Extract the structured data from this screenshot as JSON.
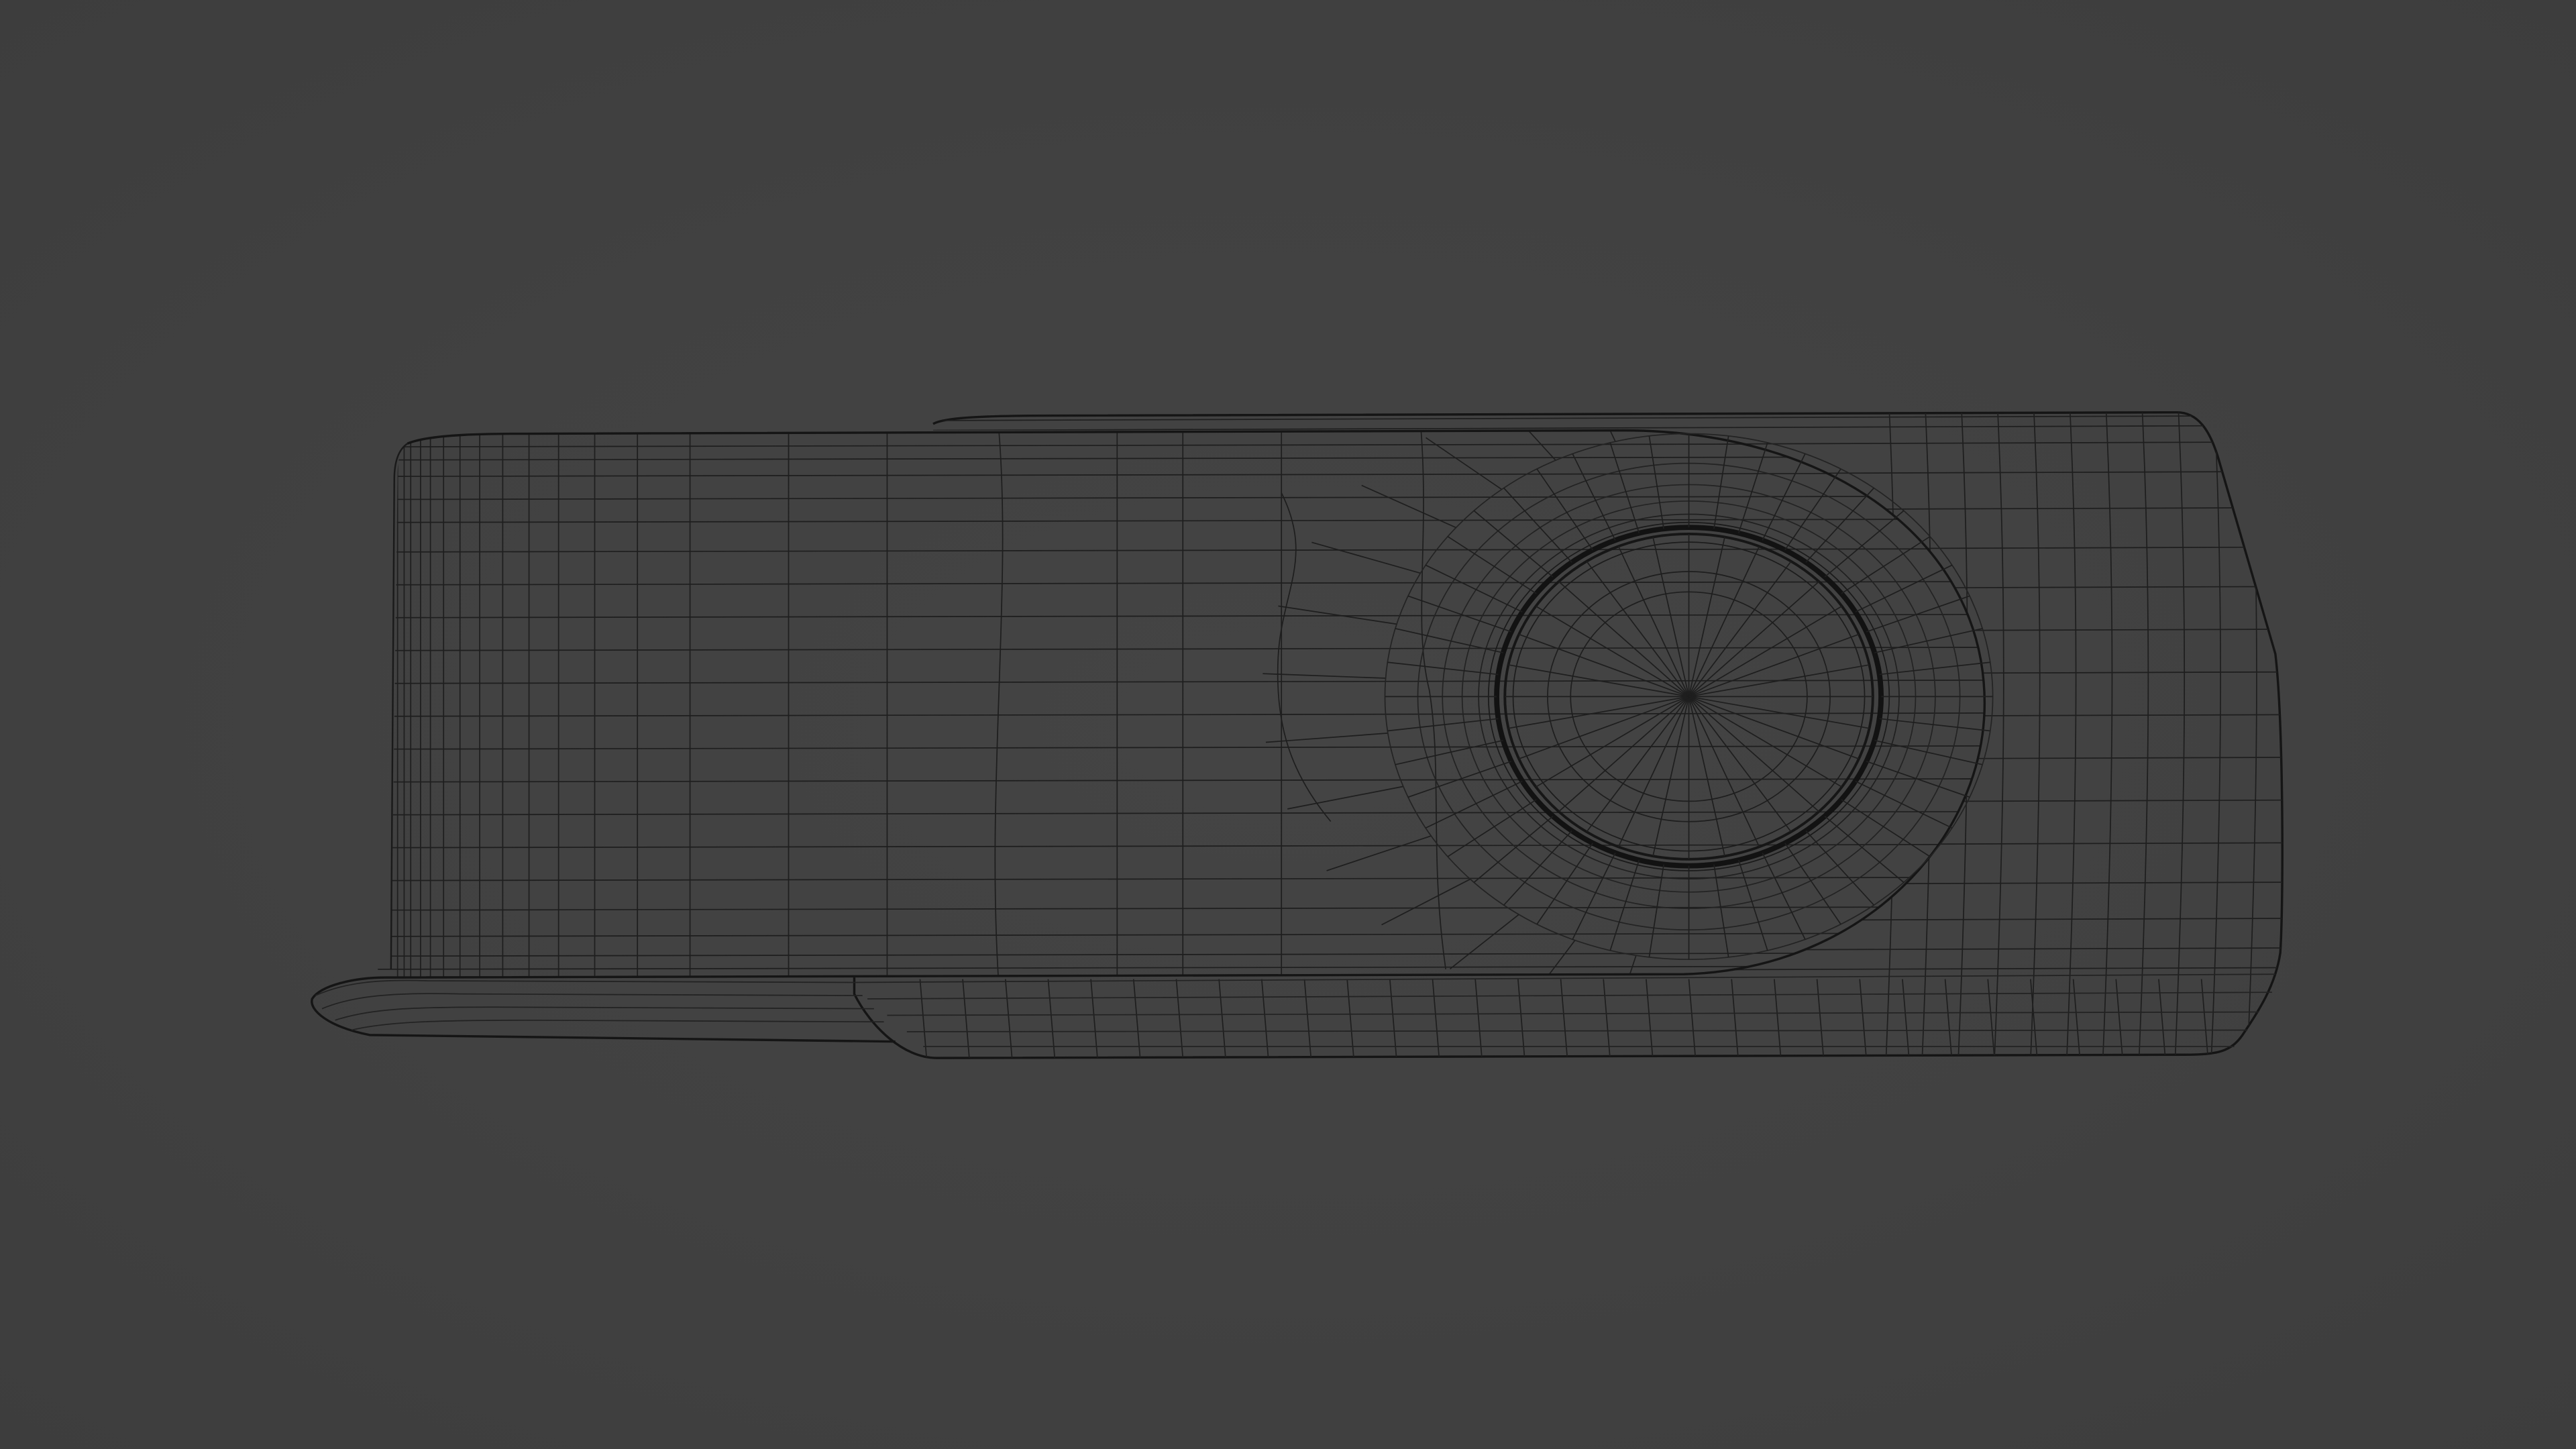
{
  "viewport": {
    "background": "#414141",
    "wire_color": "#1c1c1c",
    "edge_color": "#141414"
  },
  "object": {
    "kind": "usb-swivel-flash-drive",
    "display_mode": "wireframe"
  }
}
